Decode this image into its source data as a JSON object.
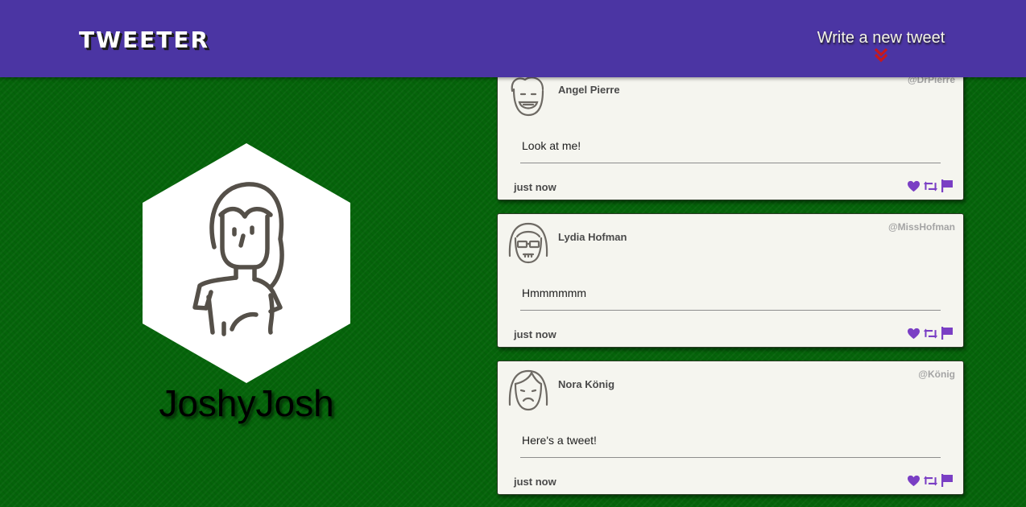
{
  "nav": {
    "logo": "TWEETER",
    "compose_label": "Write a new tweet",
    "compose_icon": "double-chevron-down-icon",
    "colors": {
      "bar": "#4b35a3",
      "arrow": "#c8171c"
    }
  },
  "profile": {
    "username": "JoshyJosh",
    "avatar_icon": "user-avatar-icon"
  },
  "tweets": [
    {
      "name": "Angel Pierre",
      "handle": "@DrPierre",
      "text": "Look at me!",
      "time": "just now",
      "avatar_icon": "smiling-man-avatar-icon"
    },
    {
      "name": "Lydia Hofman",
      "handle": "@MissHofman",
      "text": "Hmmmmmm",
      "time": "just now",
      "avatar_icon": "woman-sunglasses-avatar-icon"
    },
    {
      "name": "Nora König",
      "handle": "@König",
      "text": "Here's a tweet!",
      "time": "just now",
      "avatar_icon": "frowning-woman-avatar-icon"
    }
  ],
  "colors": {
    "background": "#05640a",
    "card": "#f5f5ef",
    "action": "#7a3fc4"
  }
}
